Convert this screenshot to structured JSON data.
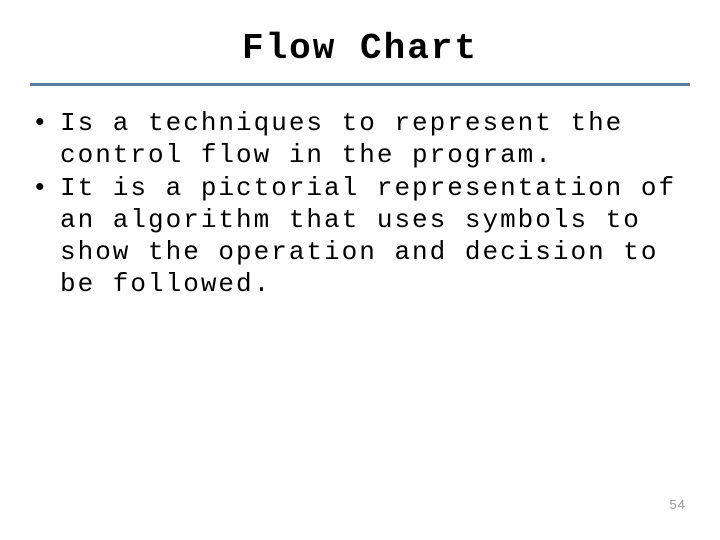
{
  "title": "Flow Chart",
  "bullets": [
    "Is a techniques to represent the control flow in the program.",
    "It is a pictorial representation of an algorithm that uses symbols to show the operation and decision to be followed."
  ],
  "page_number": "54"
}
